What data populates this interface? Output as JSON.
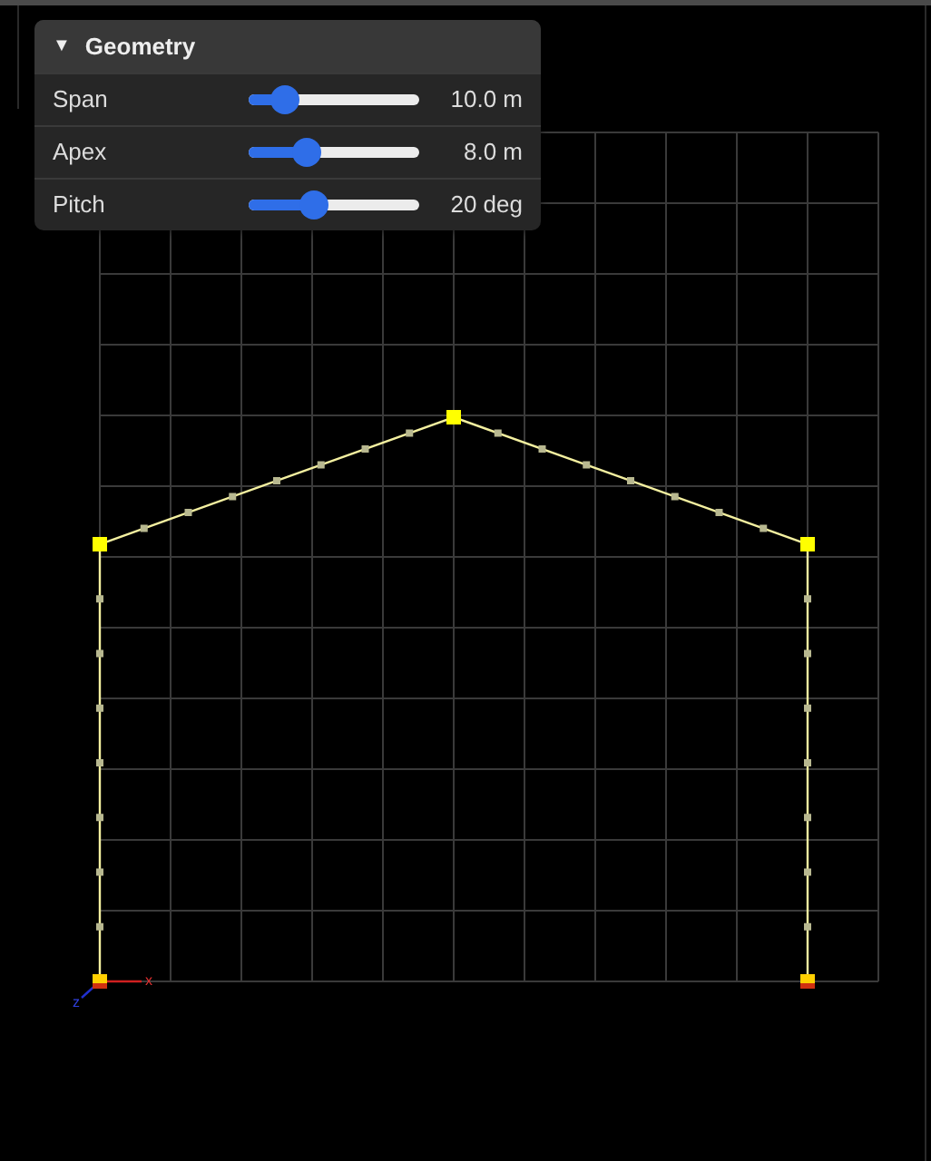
{
  "panel": {
    "toggle": "▼",
    "title": "Geometry",
    "expanded": true,
    "rows": [
      {
        "label": "Span",
        "level": 0.21,
        "reading": "10.0 m"
      },
      {
        "label": "Apex",
        "level": 0.34,
        "reading": "8.0 m"
      },
      {
        "label": "Pitch",
        "level": 0.38,
        "reading": "20 deg"
      }
    ]
  },
  "viewport": {
    "axis_labels": [
      {
        "kind": "x",
        "text": "x"
      },
      {
        "kind": "z",
        "text": "z"
      }
    ]
  }
}
